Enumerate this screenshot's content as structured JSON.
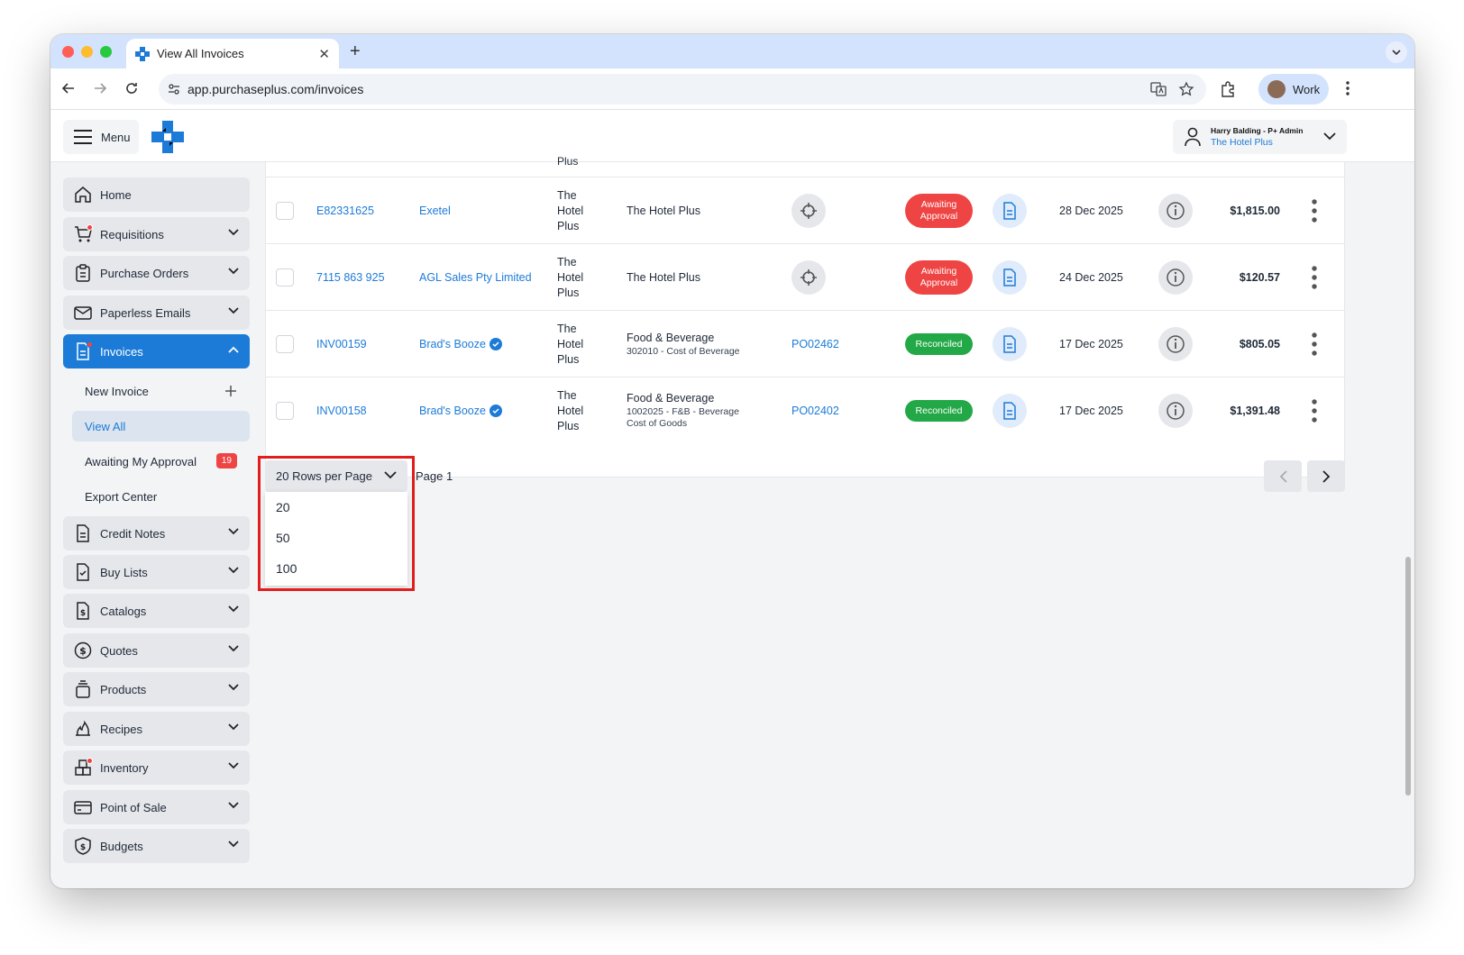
{
  "browser": {
    "tab_title": "View All Invoices",
    "url": "app.purchaseplus.com/invoices",
    "profile_label": "Work"
  },
  "header": {
    "menu_label": "Menu",
    "user_name": "Harry Balding - P+ Admin",
    "user_org": "The Hotel Plus"
  },
  "sidebar": {
    "items": [
      {
        "label": "Home"
      },
      {
        "label": "Requisitions"
      },
      {
        "label": "Purchase Orders"
      },
      {
        "label": "Paperless Emails"
      },
      {
        "label": "Invoices"
      },
      {
        "label": "Credit Notes"
      },
      {
        "label": "Buy Lists"
      },
      {
        "label": "Catalogs"
      },
      {
        "label": "Quotes"
      },
      {
        "label": "Products"
      },
      {
        "label": "Recipes"
      },
      {
        "label": "Inventory"
      },
      {
        "label": "Point of Sale"
      },
      {
        "label": "Budgets"
      }
    ],
    "invoice_sub": [
      {
        "label": "New Invoice"
      },
      {
        "label": "View All"
      },
      {
        "label": "Awaiting My Approval",
        "badge": "19"
      },
      {
        "label": "Export Center"
      }
    ]
  },
  "table": {
    "partial_text": "Plus",
    "rows": [
      {
        "ref": "E82331625",
        "supplier": "Exetel",
        "org": [
          "The",
          "Hotel",
          "Plus"
        ],
        "dept": "The Hotel Plus",
        "dept_sub": "",
        "po": "",
        "status": "Awaiting Approval",
        "date": "28 Dec 2025",
        "amount": "$1,815.00"
      },
      {
        "ref": "7115 863 925",
        "supplier": "AGL Sales Pty Limited",
        "org": [
          "The",
          "Hotel",
          "Plus"
        ],
        "dept": "The Hotel Plus",
        "dept_sub": "",
        "po": "",
        "status": "Awaiting Approval",
        "date": "24 Dec 2025",
        "amount": "$120.57"
      },
      {
        "ref": "INV00159",
        "supplier": "Brad's Booze",
        "org": [
          "The",
          "Hotel",
          "Plus"
        ],
        "dept": "Food & Beverage",
        "dept_sub": "302010 - Cost of Beverage",
        "po": "PO02462",
        "status": "Reconciled",
        "date": "17 Dec 2025",
        "amount": "$805.05"
      },
      {
        "ref": "INV00158",
        "supplier": "Brad's Booze",
        "org": [
          "The",
          "Hotel",
          "Plus"
        ],
        "dept": "Food & Beverage",
        "dept_sub": "1002025 - F&B - Beverage Cost of Goods",
        "po": "PO02402",
        "status": "Reconciled",
        "date": "17 Dec 2025",
        "amount": "$1,391.48"
      }
    ]
  },
  "pagination": {
    "rows_per_page_label": "20 Rows per Page",
    "options": [
      "20",
      "50",
      "100"
    ],
    "page_label": "Page 1"
  },
  "colors": {
    "accent": "#1d7bd8",
    "reconciled": "#22a846",
    "awaiting": "#ef4444",
    "highlight": "#e11d1d"
  }
}
